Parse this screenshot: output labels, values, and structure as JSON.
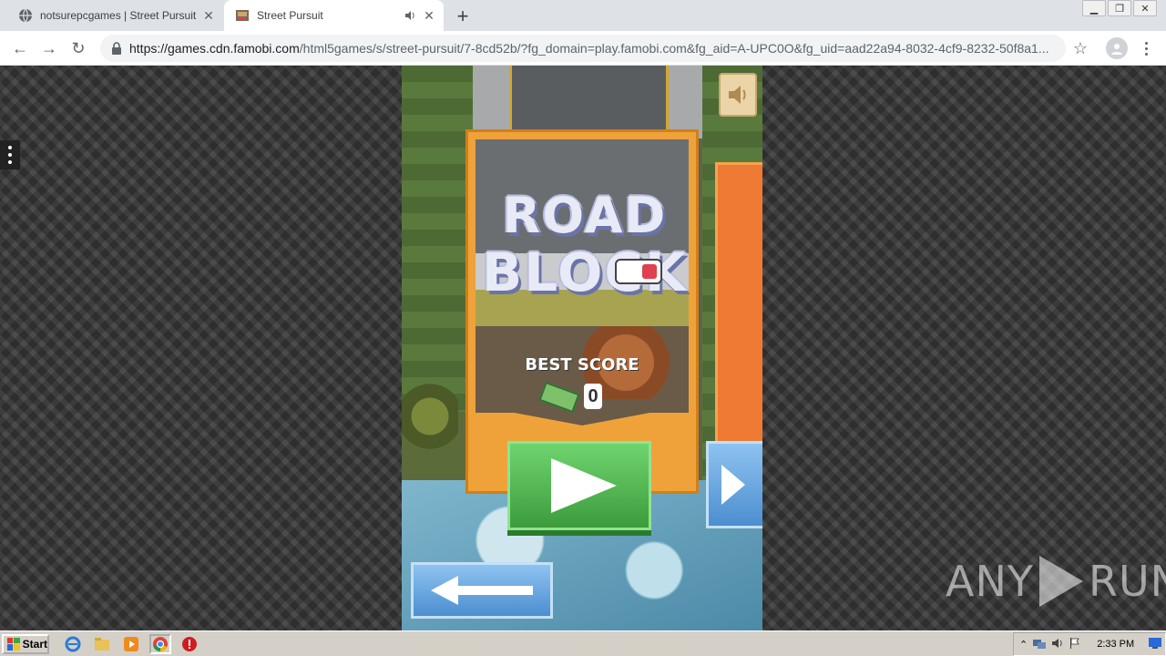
{
  "browser": {
    "tabs": [
      {
        "title": "notsurepcgames | Street Pursuit",
        "active": false
      },
      {
        "title": "Street Pursuit",
        "active": true
      }
    ],
    "new_tab_label": "+",
    "url_host": "https://games.cdn.famobi.com",
    "url_path": "/html5games/s/street-pursuit/7-8cd52b/?fg_domain=play.famobi.com&fg_aid=A-UPC0O&fg_uid=aad22a94-8032-4cf9-8232-50f8a1..."
  },
  "game": {
    "logo_line1": "ROAD",
    "logo_line2": "BLOCK",
    "best_score_label": "BEST SCORE",
    "best_score_value": "0"
  },
  "watermark": {
    "left": "ANY",
    "right": "RUN"
  },
  "taskbar": {
    "start_label": "Start",
    "clock": "2:33 PM"
  },
  "colors": {
    "card_orange": "#f0a23a",
    "play_green": "#4caf50",
    "button_blue": "#4c8ed0"
  }
}
